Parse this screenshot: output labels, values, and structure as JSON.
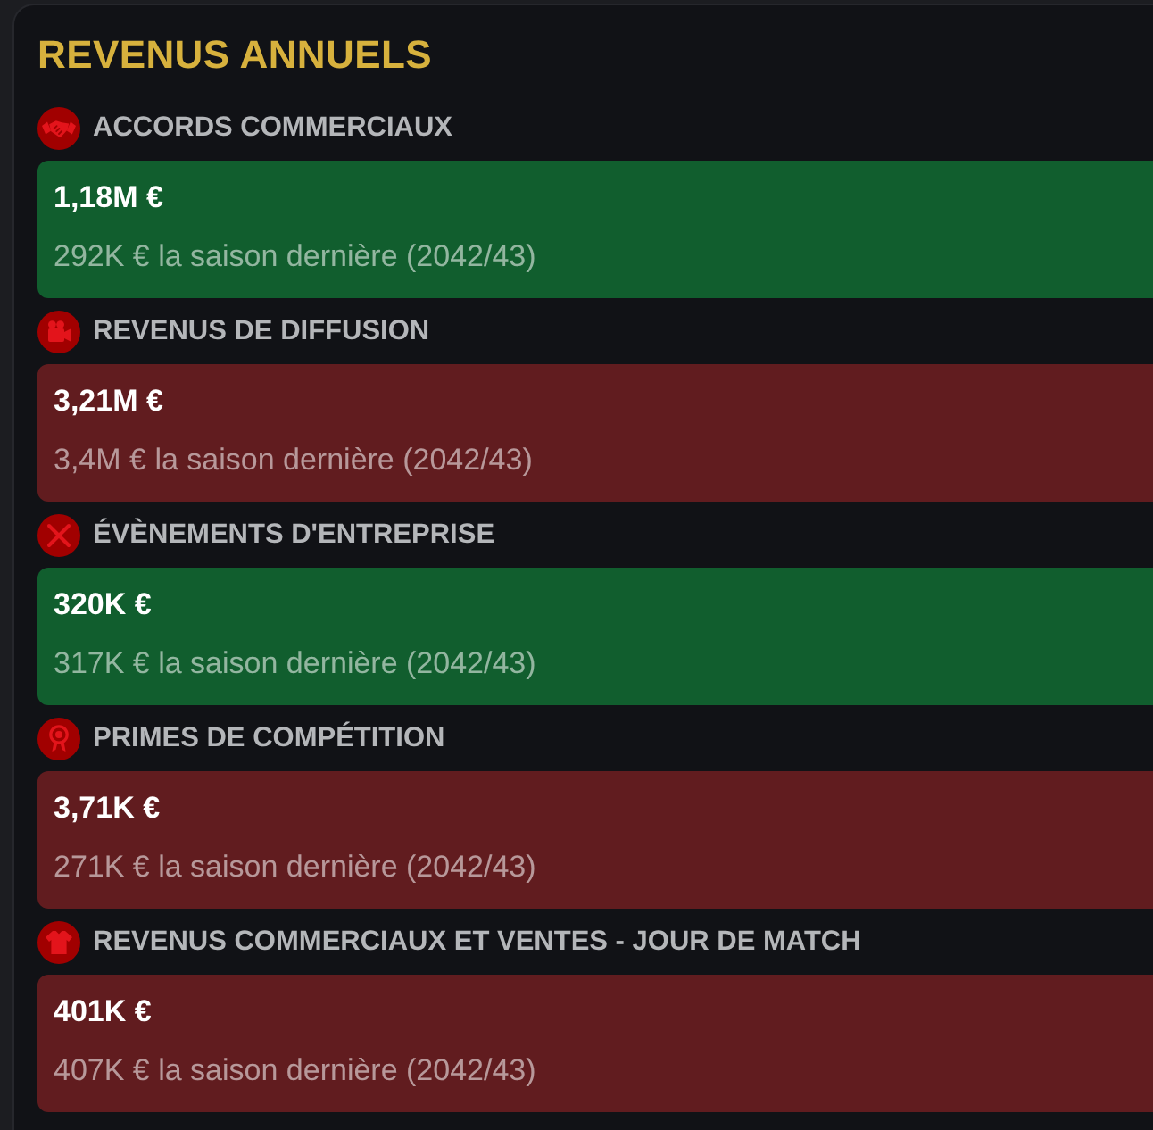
{
  "title": "REVENUS ANNUELS",
  "categories": [
    {
      "label": "ACCORDS COMMERCIAUX",
      "value": "1,18M €",
      "previous": "292K € la saison dernière (2042/43)",
      "color": "#115e2e"
    },
    {
      "label": "REVENUS DE DIFFUSION",
      "value": "3,21M €",
      "previous": "3,4M € la saison dernière (2042/43)",
      "color": "#611c1f"
    },
    {
      "label": "ÉVÈNEMENTS D'ENTREPRISE",
      "value": "320K €",
      "previous": "317K € la saison dernière (2042/43)",
      "color": "#115e2e"
    },
    {
      "label": "PRIMES DE COMPÉTITION",
      "value": "3,71K €",
      "previous": "271K € la saison dernière (2042/43)",
      "color": "#611c1f"
    },
    {
      "label": "REVENUS COMMERCIAUX ET VENTES - JOUR DE MATCH",
      "value": "401K €",
      "previous": "407K € la saison dernière (2042/43)",
      "color": "#611c1f"
    }
  ]
}
